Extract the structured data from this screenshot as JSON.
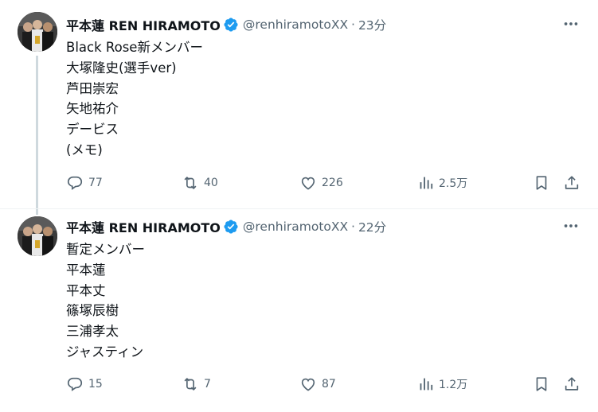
{
  "tweets": [
    {
      "name": "平本蓮 REN HIRAMOTO",
      "handle": "@renhiramotoXX",
      "separator": "·",
      "time": "23分",
      "lines": [
        "Black Rose新メンバー",
        "大塚隆史(選手ver)",
        "芦田崇宏",
        "矢地祐介",
        "デービス",
        "(メモ)"
      ],
      "stats": {
        "replies": "77",
        "reposts": "40",
        "likes": "226",
        "views": "2.5万"
      }
    },
    {
      "name": "平本蓮 REN HIRAMOTO",
      "handle": "@renhiramotoXX",
      "separator": "·",
      "time": "22分",
      "lines": [
        "暫定メンバー",
        "平本蓮",
        "平本丈",
        "篠塚辰樹",
        "三浦孝太",
        "ジャスティン"
      ],
      "stats": {
        "replies": "15",
        "reposts": "7",
        "likes": "87",
        "views": "1.2万"
      }
    }
  ],
  "icons": {
    "verified": "verified-badge-icon",
    "more": "more-dots-icon",
    "reply": "reply-bubble-icon",
    "repost": "repost-arrows-icon",
    "like": "heart-icon",
    "views": "views-bars-icon",
    "bookmark": "bookmark-icon",
    "share": "share-upload-icon"
  },
  "colors": {
    "text": "#0f1419",
    "secondary": "#536471",
    "verified": "#1d9bf0",
    "thread_line": "#cfd9de"
  }
}
